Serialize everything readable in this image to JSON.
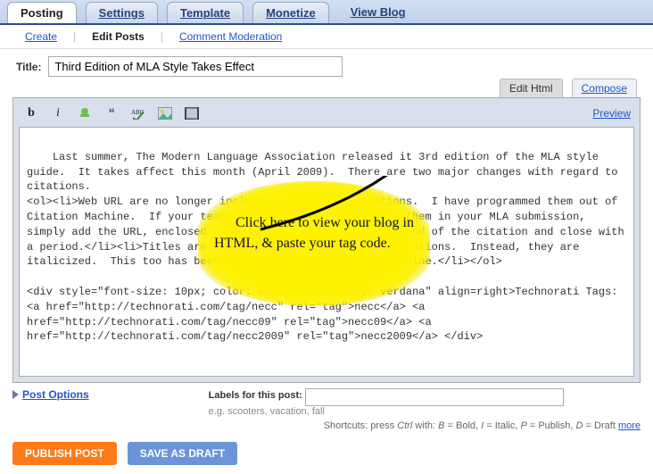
{
  "tabs": {
    "posting": "Posting",
    "settings": "Settings",
    "template": "Template",
    "monetize": "Monetize",
    "view_blog": "View Blog"
  },
  "subnav": {
    "create": "Create",
    "edit_posts": "Edit Posts",
    "comment_moderation": "Comment Moderation"
  },
  "title": {
    "label": "Title:",
    "value": "Third Edition of MLA Style Takes Effect"
  },
  "mode": {
    "edit_html": "Edit Html",
    "compose": "Compose"
  },
  "toolbar": {
    "bold": "b",
    "italic": "i",
    "preview": "Preview"
  },
  "editor_text": "Last summer, The Modern Language Association released it 3rd edition of the MLA style guide.  It takes affect this month (April 2009).  There are two major changes with regard to citations.\n<ol><li>Web URL are no longer included in standard citations.  I have programmed them out of Citation Machine.  If your teacher requires you to include them in your MLA submission, simply add the URL, enclosed within angle brackets, at the end of the citation and close with a period.</li><li>Titles are no longer underlined in the citations.  Instead, they are italicized.  This too has been programmed into Citation Machine.</li></ol>\n\n<div style=\"font-size: 10px; color: #333; font-family: verdana\" align=right>Technorati Tags: <a href=\"http://technorati.com/tag/necc\" rel=\"tag\">necc</a> <a href=\"http://technorati.com/tag/necc09\" rel=\"tag\">necc09</a> <a href=\"http://technorati.com/tag/necc2009\" rel=\"tag\">necc2009</a> </div>",
  "callout": "Click here to view your blog in HTML, & paste your tag code.",
  "bottom": {
    "post_options": "Post Options",
    "labels_label": "Labels for this post:",
    "labels_eg": "e.g. scooters, vacation, fall",
    "labels_value": ""
  },
  "shortcuts": {
    "prefix": "Shortcuts: press ",
    "ctrl": "Ctrl",
    "with": " with: ",
    "b": "B",
    "bold": " = Bold, ",
    "i": "I",
    "italic": " = Italic, ",
    "p": "P",
    "publish": " = Publish, ",
    "d": "D",
    "draft": " = Draft ",
    "more": "more"
  },
  "actions": {
    "publish": "PUBLISH POST",
    "draft": "SAVE AS DRAFT"
  }
}
